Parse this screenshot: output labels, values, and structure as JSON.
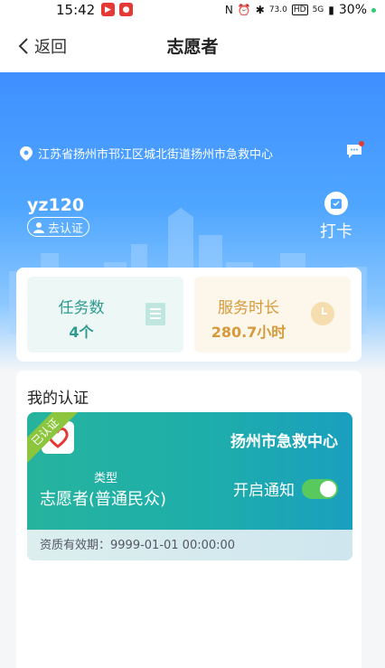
{
  "status": {
    "time": "15:42",
    "battery": "30%",
    "speed": "73.0",
    "speed_unit": "KB/S",
    "hd": "HD",
    "net": "5G"
  },
  "nav": {
    "back_label": "返回",
    "title": "志愿者"
  },
  "hero": {
    "location": "江苏省扬州市邗江区城北街道扬州市急救中心",
    "username": "yz120",
    "verify_label": "去认证",
    "checkin_label": "打卡"
  },
  "stats": {
    "tasks_label": "任务数",
    "tasks_value": "4个",
    "hours_label": "服务时长",
    "hours_value": "280.7小时"
  },
  "certification": {
    "section_title": "我的认证",
    "badge": "已认证",
    "org": "扬州市急救中心",
    "type_label": "类型",
    "type_value": "志愿者(普通民众)",
    "notify_label": "开启通知",
    "notify_on": true,
    "validity": "资质有效期：9999-01-01 00:00:00"
  },
  "colors": {
    "hero_blue": "#3f8fff",
    "card_teal": "#26b39e",
    "toggle_green": "#57c95d",
    "badge_green": "#8cc63f"
  }
}
